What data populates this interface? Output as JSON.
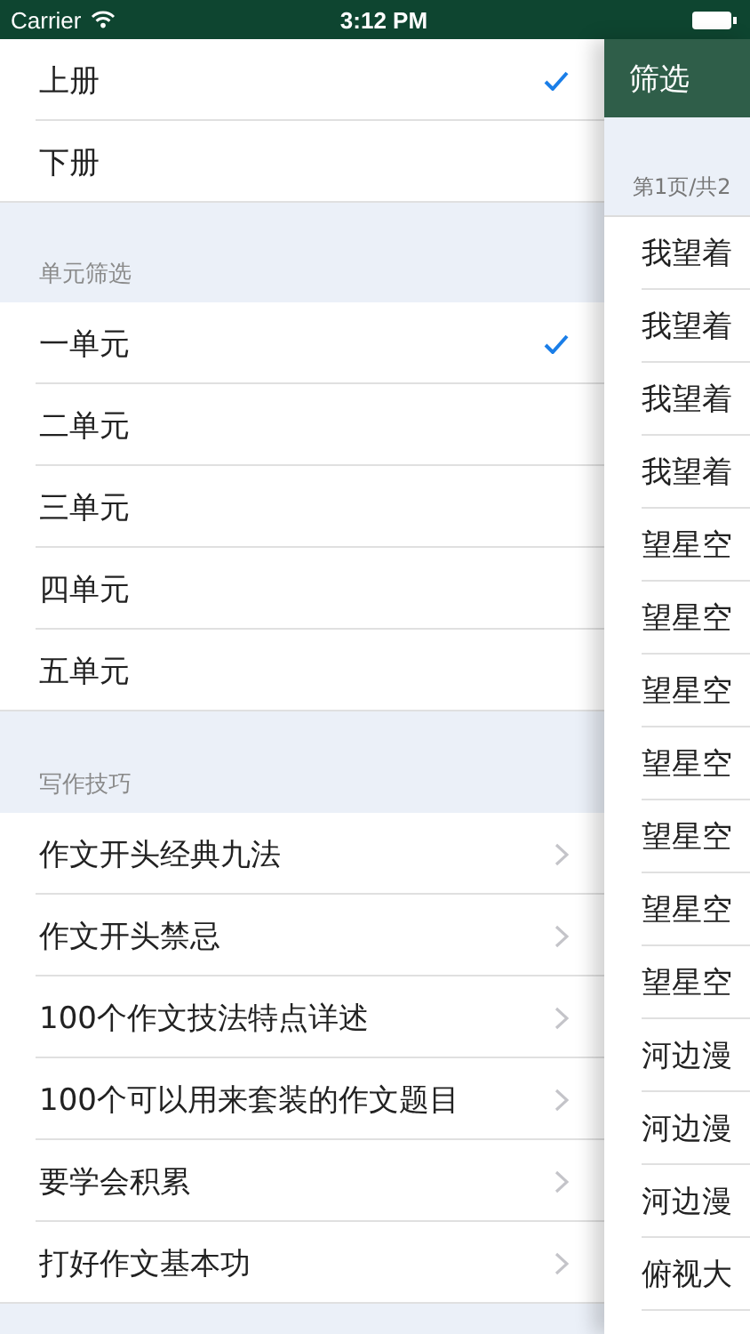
{
  "status_bar": {
    "carrier": "Carrier",
    "time": "3:12 PM"
  },
  "volume_options": [
    {
      "label": "上册",
      "selected": true
    },
    {
      "label": "下册",
      "selected": false
    }
  ],
  "unit_filter": {
    "header": "单元筛选",
    "items": [
      {
        "label": "一单元",
        "selected": true
      },
      {
        "label": "二单元",
        "selected": false
      },
      {
        "label": "三单元",
        "selected": false
      },
      {
        "label": "四单元",
        "selected": false
      },
      {
        "label": "五单元",
        "selected": false
      }
    ]
  },
  "writing_tips": {
    "header": "写作技巧",
    "items": [
      {
        "label": "作文开头经典九法"
      },
      {
        "label": "作文开头禁忌"
      },
      {
        "label": "100个作文技法特点详述"
      },
      {
        "label": "100个可以用来套装的作文题目"
      },
      {
        "label": "要学会积累"
      },
      {
        "label": "打好作文基本功"
      }
    ]
  },
  "filter_panel": {
    "title": "筛选",
    "page_info": "第1页/共2",
    "items": [
      {
        "label": "我望着"
      },
      {
        "label": "我望着"
      },
      {
        "label": "我望着"
      },
      {
        "label": "我望着"
      },
      {
        "label": "望星空"
      },
      {
        "label": "望星空"
      },
      {
        "label": "望星空"
      },
      {
        "label": "望星空"
      },
      {
        "label": "望星空"
      },
      {
        "label": "望星空"
      },
      {
        "label": "望星空"
      },
      {
        "label": "河边漫"
      },
      {
        "label": "河边漫"
      },
      {
        "label": "河边漫"
      },
      {
        "label": "俯视大"
      }
    ]
  }
}
